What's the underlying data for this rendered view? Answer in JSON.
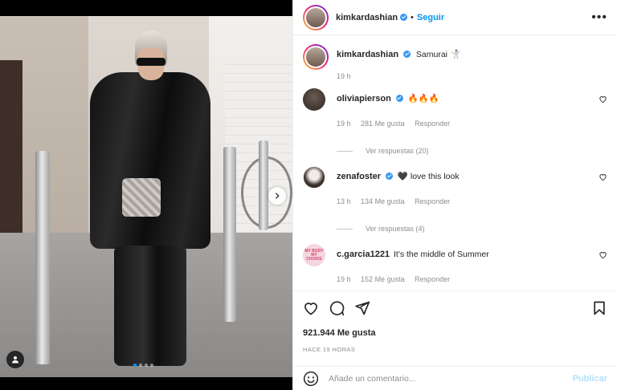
{
  "post": {
    "author": "kimkardashian",
    "follow_label": "Seguir",
    "separator": "•",
    "more_label": "•••",
    "caption": {
      "username": "kimkardashian",
      "text": "Samurai 🤺",
      "time": "19 h"
    },
    "image": {
      "carousel_count": 4,
      "active_index": 0
    }
  },
  "comments": [
    {
      "username": "oliviapierson",
      "verified": true,
      "text": "🔥🔥🔥",
      "time": "19 h",
      "likes": "281 Me gusta",
      "reply_label": "Responder",
      "view_replies": "Ver respuestas (20)"
    },
    {
      "username": "zenafoster",
      "verified": true,
      "text": "🖤 love this look",
      "time": "13 h",
      "likes": "134 Me gusta",
      "reply_label": "Responder",
      "view_replies": "Ver respuestas (4)"
    },
    {
      "username": "c.garcia1221",
      "verified": false,
      "text": "It's the middle of Summer",
      "time": "19 h",
      "likes": "152 Me gusta",
      "reply_label": "Responder",
      "avatar_text": "MY BODY MY CHOICE"
    }
  ],
  "actions": {
    "likes": "921.944 Me gusta",
    "posted_ago": "HACE 19 HORAS"
  },
  "add_comment": {
    "placeholder": "Añade un comentario...",
    "publish_label": "Publicar"
  },
  "colors": {
    "accent": "#0095f6",
    "verified": "#3897f0",
    "muted": "#8e8e8e",
    "publish_disabled": "#b2dffc"
  }
}
